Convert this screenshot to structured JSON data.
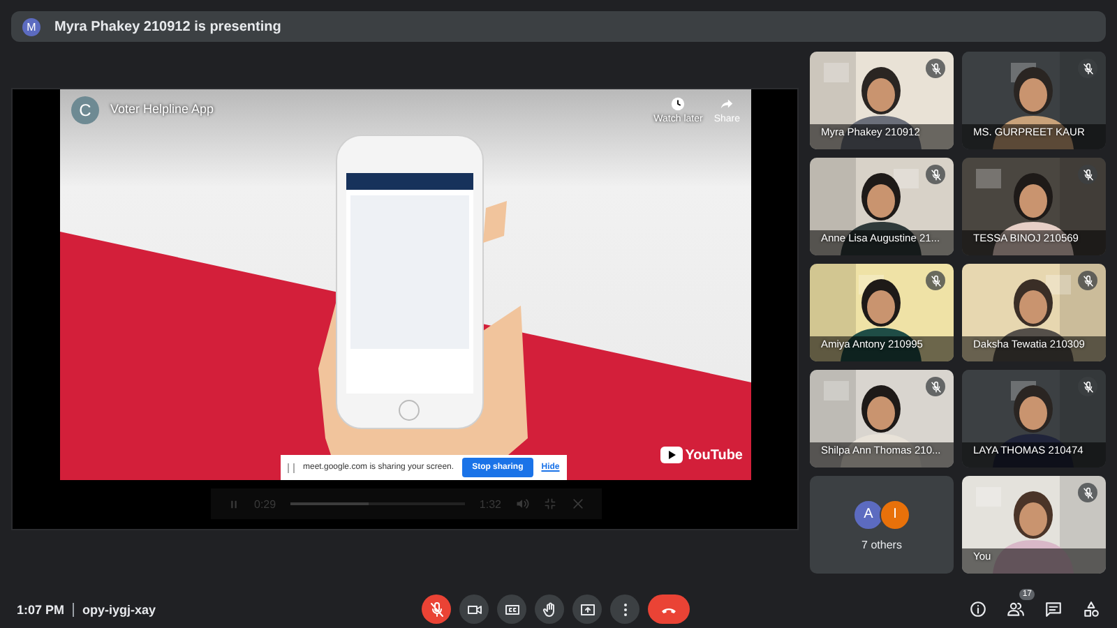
{
  "banner": {
    "avatar": "M",
    "text": "Myra Phakey 210912 is presenting"
  },
  "player": {
    "channel_avatar": "C",
    "title": "Voter Helpline App",
    "actions": [
      {
        "kind": "watch_later",
        "label": "Watch later"
      },
      {
        "kind": "share",
        "label": "Share"
      }
    ],
    "logo": "YouTube",
    "controls": {
      "elapsed": "0:29",
      "duration": "1:32",
      "level": 0.45
    }
  },
  "share_notice": {
    "text": "meet.google.com is sharing your screen.",
    "buttons": [
      {
        "kind": "primary",
        "label": "Stop sharing"
      },
      {
        "kind": "link",
        "label": "Hide"
      }
    ]
  },
  "tiles": [
    {
      "kind": "camera",
      "name": "Myra Phakey 210912",
      "muted": true
    },
    {
      "kind": "camera",
      "name": "MS. GURPREET KAUR",
      "muted": true
    },
    {
      "kind": "camera",
      "name": "Anne Lisa Augustine 21...",
      "muted": true
    },
    {
      "kind": "camera",
      "name": "TESSA BINOJ 210569",
      "muted": true
    },
    {
      "kind": "camera",
      "name": "Amiya Antony 210995",
      "muted": true
    },
    {
      "kind": "camera",
      "name": "Daksha Tewatia 210309",
      "muted": true
    },
    {
      "kind": "camera",
      "name": "Shilpa Ann Thomas 210...",
      "muted": true
    },
    {
      "kind": "camera",
      "name": "LAYA THOMAS 210474",
      "muted": true
    },
    {
      "kind": "others",
      "label": "7 others",
      "avatars": [
        {
          "letter": "A",
          "color": "#5c6bc0"
        },
        {
          "letter": "I",
          "color": "#e8710a"
        }
      ]
    },
    {
      "kind": "camera",
      "name": "You",
      "muted": true
    }
  ],
  "bottom_bar": {
    "time": "1:07 PM",
    "meeting_code": "opy-iygj-xay",
    "controls": [
      {
        "kind": "mic",
        "on": false
      },
      {
        "kind": "camera",
        "on": true
      },
      {
        "kind": "captions"
      },
      {
        "kind": "raise_hand"
      },
      {
        "kind": "present"
      },
      {
        "kind": "more"
      },
      {
        "kind": "leave"
      }
    ],
    "side": [
      {
        "kind": "info"
      },
      {
        "kind": "people",
        "badge": "17"
      },
      {
        "kind": "chat"
      },
      {
        "kind": "activities"
      }
    ]
  }
}
